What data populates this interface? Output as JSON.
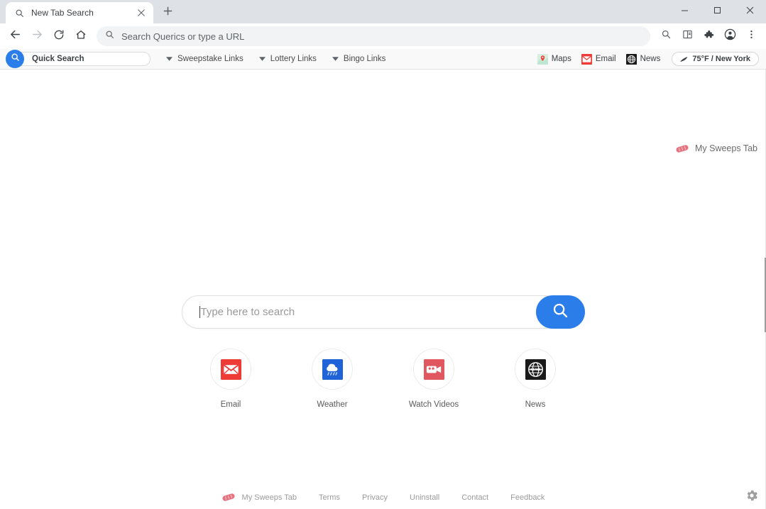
{
  "window": {
    "minimize_label": "Minimize",
    "maximize_label": "Maximize",
    "close_label": "Close"
  },
  "tabstrip": {
    "tab_title": "New Tab Search",
    "close_tab_label": "Close tab",
    "new_tab_label": "New tab"
  },
  "toolbar": {
    "back_label": "Back",
    "forward_label": "Forward",
    "reload_label": "Reload",
    "home_label": "Home",
    "omnibox_placeholder": "Search Querics or type a URL",
    "zoom_label": "Zoom",
    "reading_list_label": "Reading list",
    "extensions_label": "Extensions",
    "profile_label": "Profile",
    "menu_label": "Customize and control Google Chrome"
  },
  "extension_bar": {
    "quick_search_value": "Quick Search",
    "quick_search_placeholder": "Quick Search",
    "dropdowns": [
      {
        "label": "Sweepstake Links"
      },
      {
        "label": "Lottery Links"
      },
      {
        "label": "Bingo Links"
      }
    ],
    "links": [
      {
        "label": "Maps",
        "icon": "maps-icon"
      },
      {
        "label": "Email",
        "icon": "email-icon"
      },
      {
        "label": "News",
        "icon": "news-icon"
      }
    ],
    "weather": {
      "temperature": "75°F",
      "separator": "/",
      "location": "New York",
      "text": "75°F / New York",
      "icon": "weather-icon"
    }
  },
  "page": {
    "brand": {
      "label": "My Sweeps Tab",
      "logo_icon": "ticket-icon",
      "logo_color": "#e8737f"
    },
    "search": {
      "placeholder": "Type here to search",
      "value": "",
      "button_icon": "search-icon",
      "button_color": "#2b7de9"
    },
    "shortcuts": [
      {
        "label": "Email",
        "icon": "envelope-icon",
        "color": "#ef3b36"
      },
      {
        "label": "Weather",
        "icon": "cloud-rain-icon",
        "color": "#2063d8"
      },
      {
        "label": "Watch Videos",
        "icon": "video-camera-icon",
        "color": "#e0575f"
      },
      {
        "label": "News",
        "icon": "globe-news-icon",
        "color": "#1a1a1a"
      }
    ],
    "footer": {
      "brand_label": "My Sweeps Tab",
      "links": [
        {
          "label": "Terms"
        },
        {
          "label": "Privacy"
        },
        {
          "label": "Uninstall"
        },
        {
          "label": "Contact"
        },
        {
          "label": "Feedback"
        }
      ],
      "settings_icon": "gear-icon"
    }
  }
}
